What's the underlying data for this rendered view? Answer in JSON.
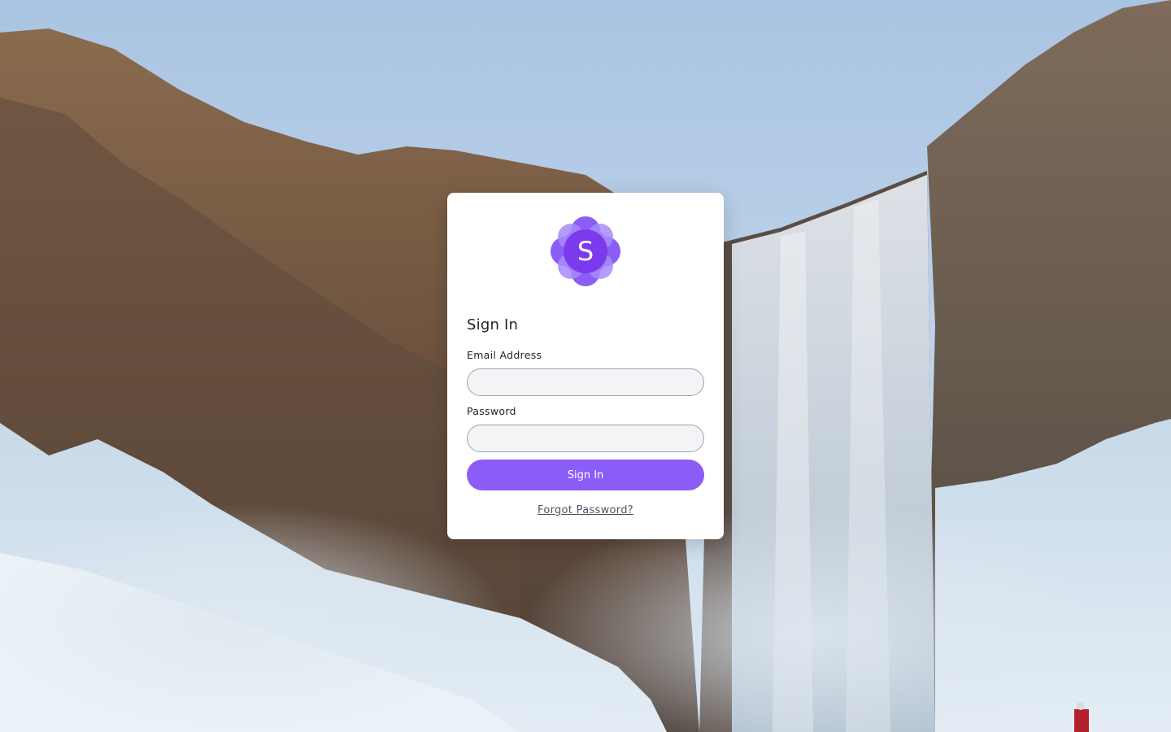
{
  "brand": {
    "logo_letter": "S",
    "logo_color": "#7c3aed",
    "logo_light": "#a78bfa"
  },
  "login": {
    "title": "Sign In",
    "email_label": "Email Address",
    "email_value": "",
    "password_label": "Password",
    "password_value": "",
    "submit_label": "Sign In",
    "forgot_link": "Forgot Password?"
  },
  "colors": {
    "accent": "#8b5cf6",
    "card_bg": "#ffffff",
    "input_bg": "#f3f4f6"
  }
}
